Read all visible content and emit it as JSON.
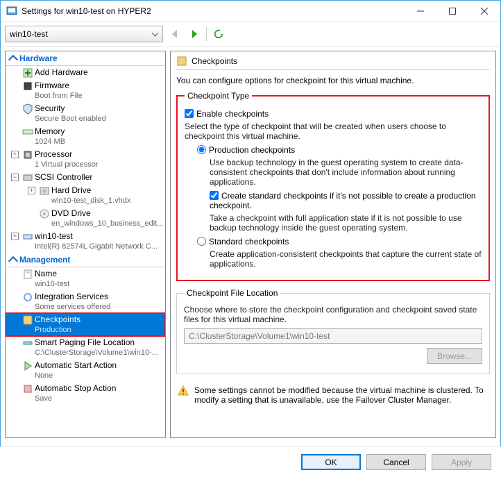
{
  "window": {
    "title": "Settings for win10-test on HYPER2"
  },
  "toolbar": {
    "vm": "win10-test"
  },
  "sidebar": {
    "hardware_header": "Hardware",
    "management_header": "Management",
    "hw": [
      {
        "label": "Add Hardware",
        "sub": ""
      },
      {
        "label": "Firmware",
        "sub": "Boot from File"
      },
      {
        "label": "Security",
        "sub": "Secure Boot enabled"
      },
      {
        "label": "Memory",
        "sub": "1024 MB"
      },
      {
        "label": "Processor",
        "sub": "1 Virtual processor"
      },
      {
        "label": "SCSI Controller",
        "sub": ""
      },
      {
        "label": "Hard Drive",
        "sub": "win10-test_disk_1.vhdx"
      },
      {
        "label": "DVD Drive",
        "sub": "en_windows_10_business_edit..."
      },
      {
        "label": "win10-test",
        "sub": "Intel(R) 82574L Gigabit Network C..."
      }
    ],
    "mg": [
      {
        "label": "Name",
        "sub": "win10-test"
      },
      {
        "label": "Integration Services",
        "sub": "Some services offered"
      },
      {
        "label": "Checkpoints",
        "sub": "Production"
      },
      {
        "label": "Smart Paging File Location",
        "sub": "C:\\ClusterStorage\\Volume1\\win10-..."
      },
      {
        "label": "Automatic Start Action",
        "sub": "None"
      },
      {
        "label": "Automatic Stop Action",
        "sub": "Save"
      }
    ]
  },
  "content": {
    "title": "Checkpoints",
    "intro": "You can configure options for checkpoint for this virtual machine.",
    "type_group": "Checkpoint Type",
    "enable_cb": "Enable checkpoints",
    "select_desc": "Select the type of checkpoint that will be created when users choose to checkpoint this virtual machine.",
    "prod_radio": "Production checkpoints",
    "prod_desc": "Use backup technology in the guest operating system to create data-consistent checkpoints that don't include information about running applications.",
    "fallback_cb": "Create standard checkpoints if it's not possible to create a production checkpoint.",
    "fallback_desc": "Take a checkpoint with full application state if it is not possible to use backup technology inside the guest operating system.",
    "std_radio": "Standard checkpoints",
    "std_desc": "Create application-consistent checkpoints that capture the current state of applications.",
    "loc_group": "Checkpoint File Location",
    "loc_desc": "Choose where to store the checkpoint configuration and checkpoint saved state files for this virtual machine.",
    "loc_path": "C:\\ClusterStorage\\Volume1\\win10-test",
    "browse": "Browse...",
    "warning": "Some settings cannot be modified because the virtual machine is clustered. To modify a setting that is unavailable, use the Failover Cluster Manager."
  },
  "buttons": {
    "ok": "OK",
    "cancel": "Cancel",
    "apply": "Apply"
  }
}
